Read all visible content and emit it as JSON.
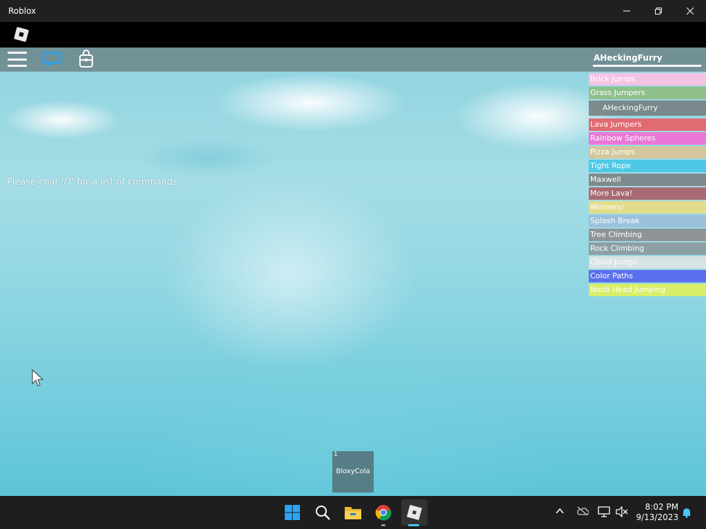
{
  "window": {
    "title": "Roblox"
  },
  "game": {
    "player_name": "AHeckingFurry",
    "chat_hint": "Please chat '/?' for a list of commands",
    "checkpoints": [
      {
        "label": "Brick Jumps",
        "color": "#f4c3e4"
      },
      {
        "label": "Grass Jumpers",
        "color": "#8fbf8a"
      },
      {
        "label": "AHeckingFurry",
        "color": "#6d6d6d",
        "is_player": true
      },
      {
        "label": "Lava Jumpers",
        "color": "#e06b72"
      },
      {
        "label": "Rainbow Spheres",
        "color": "#e978d6"
      },
      {
        "label": "Pizza Jumps",
        "color": "#d4c79e"
      },
      {
        "label": "Tight Rope",
        "color": "#4ec8e6"
      },
      {
        "label": "Maxwell",
        "color": "#7e8a8e"
      },
      {
        "label": "More Lava!",
        "color": "#a86a72"
      },
      {
        "label": "Winners!",
        "color": "#e3dc8a"
      },
      {
        "label": "Splash Break",
        "color": "#9cc1dc"
      },
      {
        "label": "Tree Climbing",
        "color": "#8f9496"
      },
      {
        "label": "Rock Climbing",
        "color": "#8c9fa4"
      },
      {
        "label": "Cloud Jumps",
        "color": "#d8e3e6"
      },
      {
        "label": "Color Paths",
        "color": "#5b70ec"
      },
      {
        "label": "Noob Head Jumping",
        "color": "#d7ee69"
      }
    ],
    "hotbar": {
      "slot_number": "1",
      "item_name": "BloxyCola"
    }
  },
  "taskbar": {
    "icons": [
      "windows-start-icon",
      "search-icon",
      "file-explorer-icon",
      "chrome-icon",
      "roblox-icon"
    ],
    "clock": {
      "time": "8:02 PM",
      "date": "9/13/2023"
    }
  }
}
